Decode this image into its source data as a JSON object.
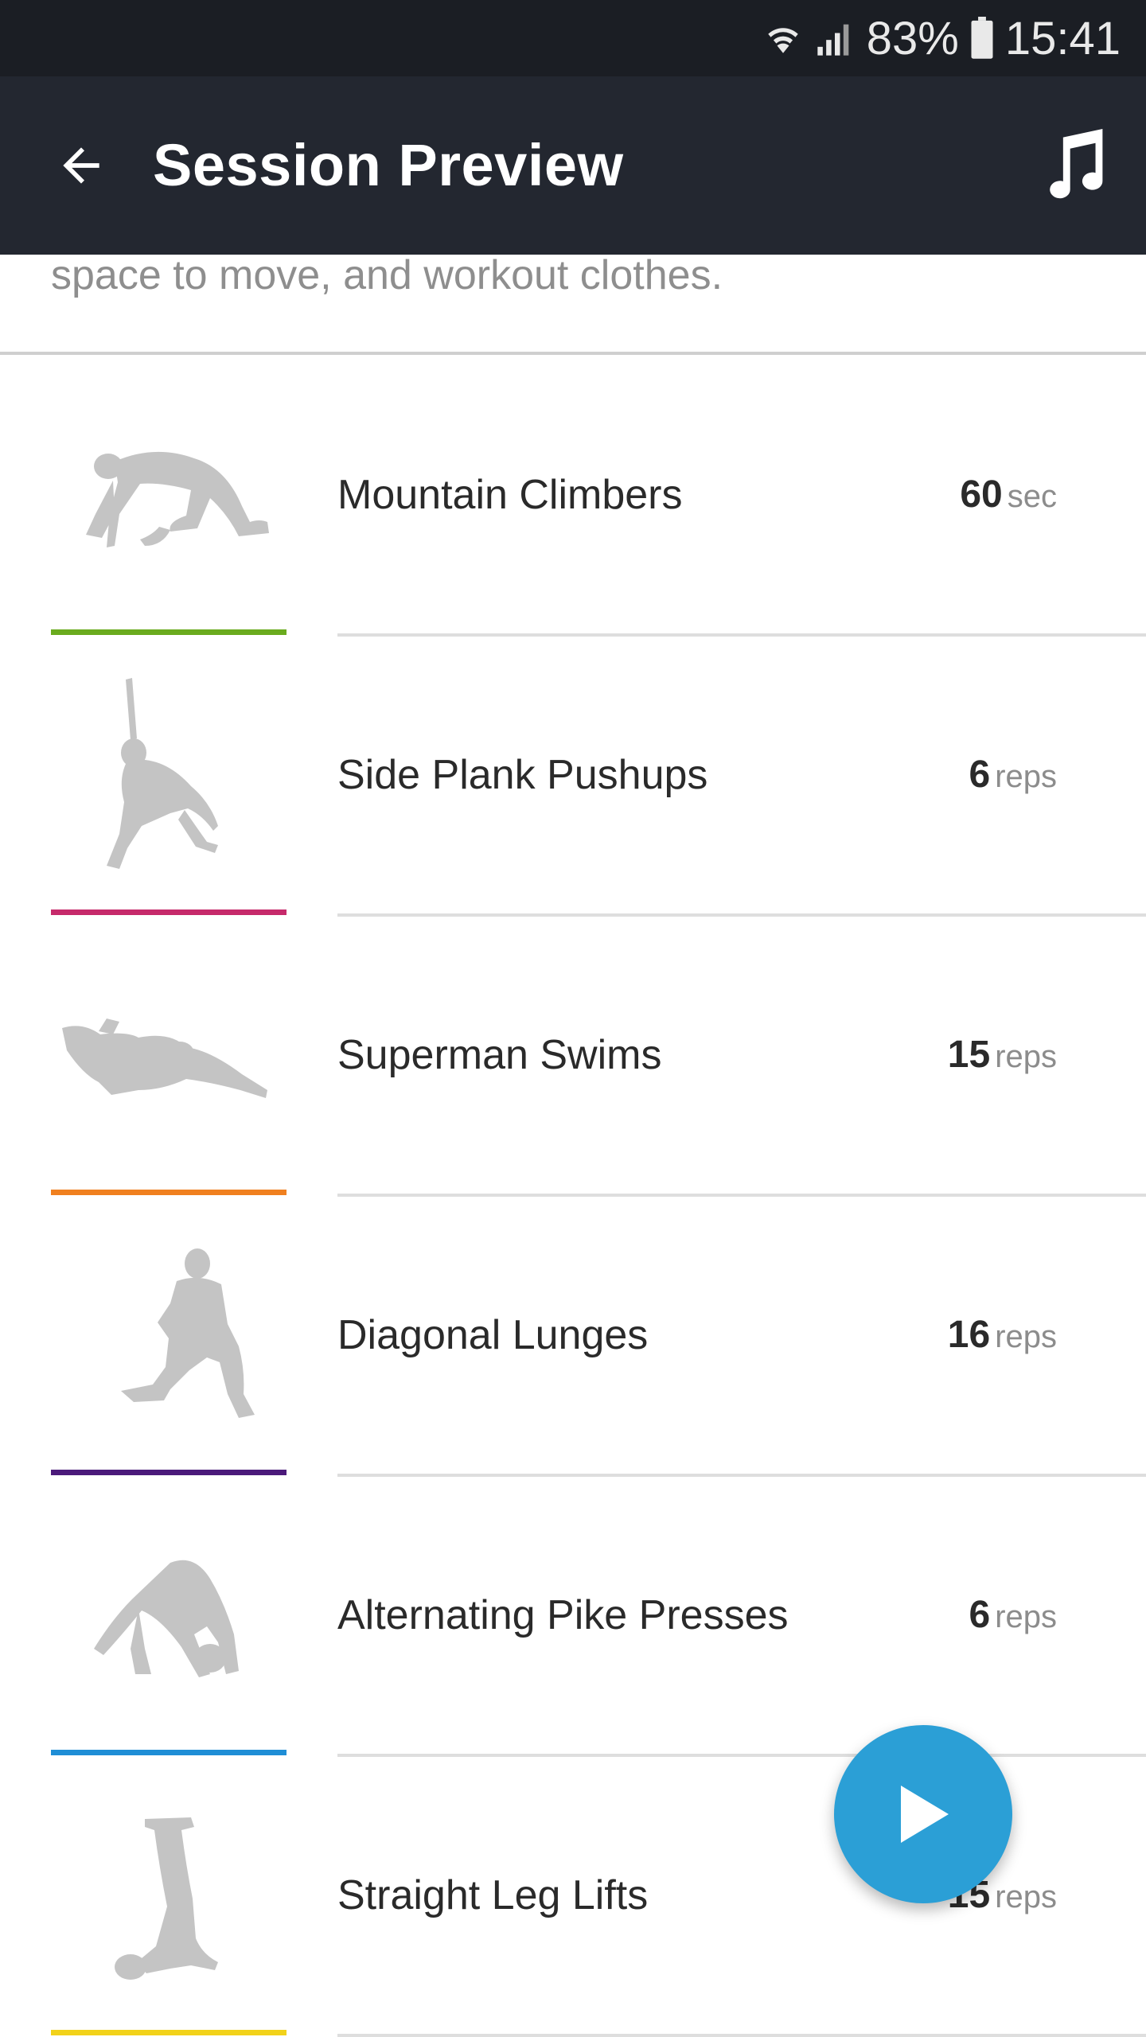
{
  "status_bar": {
    "battery_percent": "83%",
    "time": "15:41",
    "icons": [
      "wifi-icon",
      "signal-icon",
      "battery-icon"
    ]
  },
  "app_bar": {
    "title": "Session Preview",
    "back_icon": "arrow-back-icon",
    "music_icon": "music-note-icon"
  },
  "intro": {
    "text": "space to move, and workout clothes."
  },
  "exercises": [
    {
      "name": "Mountain Climbers",
      "value": "60",
      "unit": "sec",
      "color": "#6aab1e"
    },
    {
      "name": "Side Plank Pushups",
      "value": "6",
      "unit": "reps",
      "color": "#c62a6b"
    },
    {
      "name": "Superman Swims",
      "value": "15",
      "unit": "reps",
      "color": "#f0801f"
    },
    {
      "name": "Diagonal Lunges",
      "value": "16",
      "unit": "reps",
      "color": "#4b1a7a"
    },
    {
      "name": "Alternating Pike Presses",
      "value": "6",
      "unit": "reps",
      "color": "#1f8ed6"
    },
    {
      "name": "Straight Leg Lifts",
      "value": "15",
      "unit": "reps",
      "color": "#f2d21a"
    }
  ],
  "fab": {
    "icon": "play-icon",
    "color": "#2b9fd6"
  }
}
